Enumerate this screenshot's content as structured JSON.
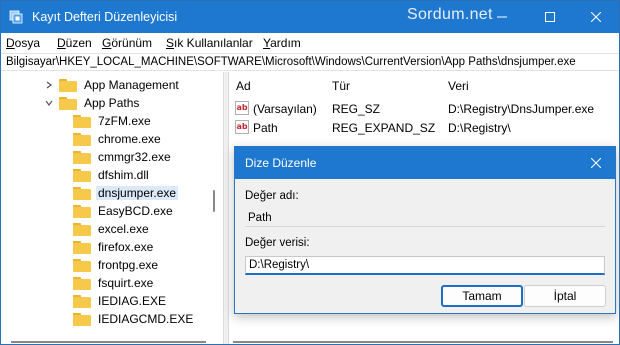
{
  "window": {
    "title": "Kayıt Defteri Düzenleyicisi",
    "watermark": "Sordum.net",
    "controls": {
      "minimize": "—",
      "maximize": "☐",
      "close": "✕"
    }
  },
  "menu": {
    "items": [
      {
        "first": "D",
        "rest": "osya"
      },
      {
        "first": "D",
        "rest": "üzen"
      },
      {
        "first": "G",
        "rest": "örünüm"
      },
      {
        "first": "S",
        "rest": "ık Kullanılanlar"
      },
      {
        "first": "Y",
        "rest": "ardım"
      }
    ]
  },
  "address": {
    "path": "Bilgisayar\\HKEY_LOCAL_MACHINE\\SOFTWARE\\Microsoft\\Windows\\CurrentVersion\\App Paths\\dnsjumper.exe"
  },
  "tree": {
    "app_management": "App Management",
    "app_paths": "App Paths",
    "items": [
      "7zFM.exe",
      "chrome.exe",
      "cmmgr32.exe",
      "dfshim.dll",
      "dnsjumper.exe",
      "EasyBCD.exe",
      "excel.exe",
      "firefox.exe",
      "frontpg.exe",
      "fsquirt.exe",
      "IEDIAG.EXE",
      "IEDIAGCMD.EXE"
    ],
    "selected_index": 4
  },
  "values": {
    "headers": {
      "name": "Ad",
      "type": "Tür",
      "data": "Veri"
    },
    "rows": [
      {
        "name": "(Varsayılan)",
        "type": "REG_SZ",
        "data": "D:\\Registry\\DnsJumper.exe"
      },
      {
        "name": "Path",
        "type": "REG_EXPAND_SZ",
        "data": "D:\\Registry\\"
      }
    ]
  },
  "dialog": {
    "title": "Dize Düzenle",
    "name_label": "Değer adı:",
    "name_value": "Path",
    "data_label": "Değer verisi:",
    "data_value": "D:\\Registry\\",
    "ok_label": "Tamam",
    "cancel_label": "İptal"
  },
  "colors": {
    "titlebar": "#1e78d0",
    "folder": "#f6c94a",
    "selection": "#dce9f8",
    "focus_accent": "#1e6fc4"
  }
}
